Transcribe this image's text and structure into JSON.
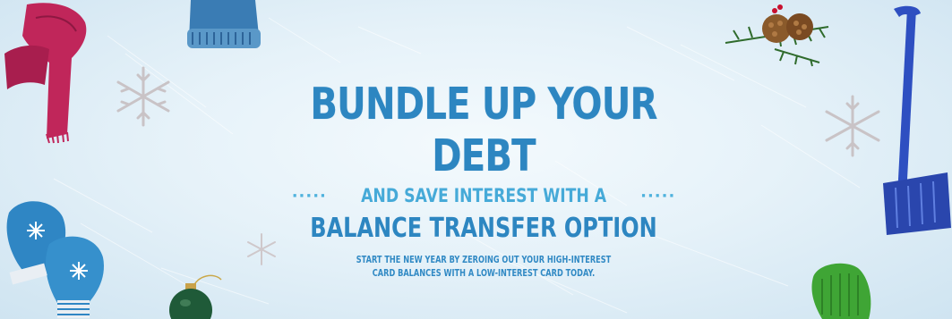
{
  "banner": {
    "headline": "BUNDLE UP YOUR DEBT",
    "dots_left": "·····",
    "subheadline": "AND SAVE INTEREST WITH A",
    "dots_right": "·····",
    "product": "BALANCE TRANSFER OPTION",
    "body_line_1": "START THE NEW YEAR BY ZEROING OUT YOUR HIGH-INTEREST",
    "body_line_2": "CARD BALANCES WITH A LOW-INTEREST CARD TODAY."
  },
  "icons": {
    "scarf": "scarf-icon",
    "hat": "knit-hat-icon",
    "mittens": "mittens-icon",
    "ornament": "ornament-icon",
    "pinecones": "pinecone-branch-icon",
    "shovel": "snow-shovel-icon",
    "glove": "glove-icon",
    "snowflake": "snowflake-icon"
  },
  "colors": {
    "headline": "#2d86c1",
    "accent": "#46aad8",
    "scarf": "#c0265a",
    "shovel": "#2e4fc1",
    "glove": "#3fa535",
    "mitten": "#2f86c4"
  }
}
